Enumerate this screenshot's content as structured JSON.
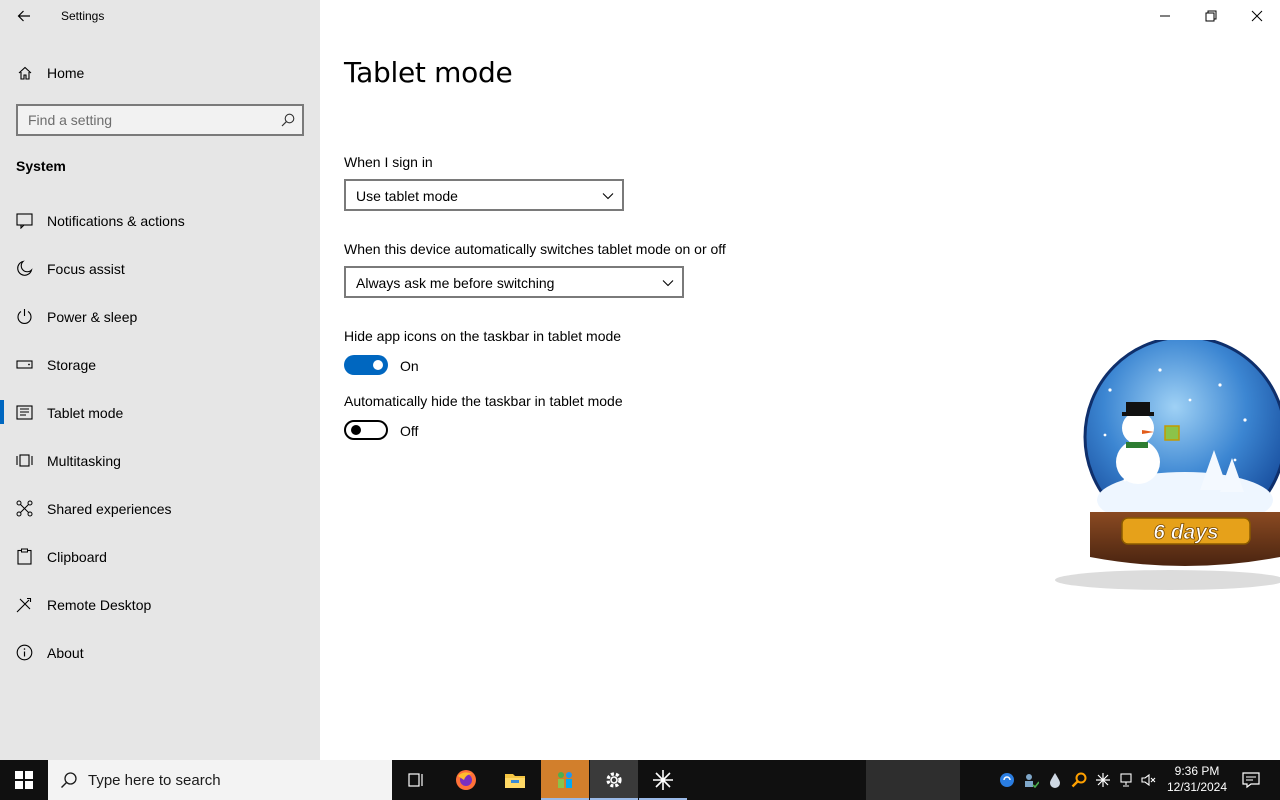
{
  "window": {
    "title": "Settings"
  },
  "sidebar": {
    "home_label": "Home",
    "search_placeholder": "Find a setting",
    "section_title": "System",
    "items": [
      {
        "label": "Notifications & actions",
        "icon": "notifications-icon"
      },
      {
        "label": "Focus assist",
        "icon": "moon-icon"
      },
      {
        "label": "Power & sleep",
        "icon": "power-icon"
      },
      {
        "label": "Storage",
        "icon": "storage-icon"
      },
      {
        "label": "Tablet mode",
        "icon": "tablet-icon",
        "active": true
      },
      {
        "label": "Multitasking",
        "icon": "multitasking-icon"
      },
      {
        "label": "Shared experiences",
        "icon": "shared-experiences-icon"
      },
      {
        "label": "Clipboard",
        "icon": "clipboard-icon"
      },
      {
        "label": "Remote Desktop",
        "icon": "remote-desktop-icon"
      },
      {
        "label": "About",
        "icon": "info-icon"
      }
    ]
  },
  "main": {
    "title": "Tablet mode",
    "sign_in": {
      "label": "When I sign in",
      "value": "Use tablet mode"
    },
    "auto_switch": {
      "label": "When this device automatically switches tablet mode on or off",
      "value": "Always ask me before switching"
    },
    "hide_icons": {
      "label": "Hide app icons on the taskbar in tablet mode",
      "state": "On",
      "on": true
    },
    "auto_hide": {
      "label": "Automatically hide the taskbar in tablet mode",
      "state": "Off",
      "on": false
    }
  },
  "widget": {
    "countdown": "6 days"
  },
  "taskbar": {
    "search_placeholder": "Type here to search",
    "time": "9:36 PM",
    "date": "12/31/2024"
  },
  "colors": {
    "accent": "#0067c0",
    "sidebar_bg": "#e6e6e6",
    "taskbar_bg": "#101010",
    "highlight": "#d27f2c"
  }
}
